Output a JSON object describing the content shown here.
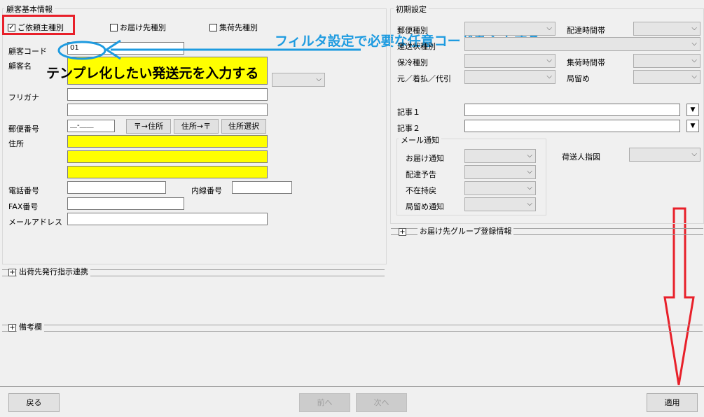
{
  "customer_basic": {
    "title": "顧客基本情報",
    "check_requester": "ご依頼主種別",
    "check_delivery": "お届け先種別",
    "check_collection": "集荷先種別",
    "code_label": "顧客コード",
    "code_value": "01",
    "name_label": "顧客名",
    "kana_label": "フリガナ",
    "postal_label": "郵便番号",
    "postal_value": "＿-＿＿",
    "btn_zip_to_addr": "〒→住所",
    "btn_addr_to_zip": "住所→〒",
    "btn_addr_select": "住所選択",
    "address_label": "住所",
    "phone_label": "電話番号",
    "ext_label": "内線番号",
    "fax_label": "FAX番号",
    "email_label": "メールアドレス"
  },
  "annotations": {
    "filter_note": "フィルタ設定で必要な任意コードを入力する",
    "template_note": "テンプレ化したい発送元を入力する",
    "accent_red": "#e8202a",
    "accent_blue": "#1e9be0"
  },
  "initial_settings": {
    "title": "初期設定",
    "mail_type": "郵便種別",
    "delivery_time": "配達時間帯",
    "shipping_type": "運送状種別",
    "cold_type": "保冷種別",
    "pickup_time": "集荷時間帯",
    "payment": "元／着払／代引",
    "office_hold": "局留め",
    "note1": "記事１",
    "note2": "記事２",
    "mail_notice_title": "メール通知",
    "mail_delivery_notice": "お届け通知",
    "mail_delivery_forecast": "配達予告",
    "mail_absent": "不在持戻",
    "mail_office_hold": "局留め通知",
    "sender_label": "荷送人指図"
  },
  "sections": {
    "group_reg": "お届け先グループ登録情報",
    "shipping_instruction": "出荷先発行指示連携",
    "remarks": "備考欄"
  },
  "footer": {
    "back": "戻る",
    "prev": "前へ",
    "next": "次へ",
    "apply": "適用"
  }
}
